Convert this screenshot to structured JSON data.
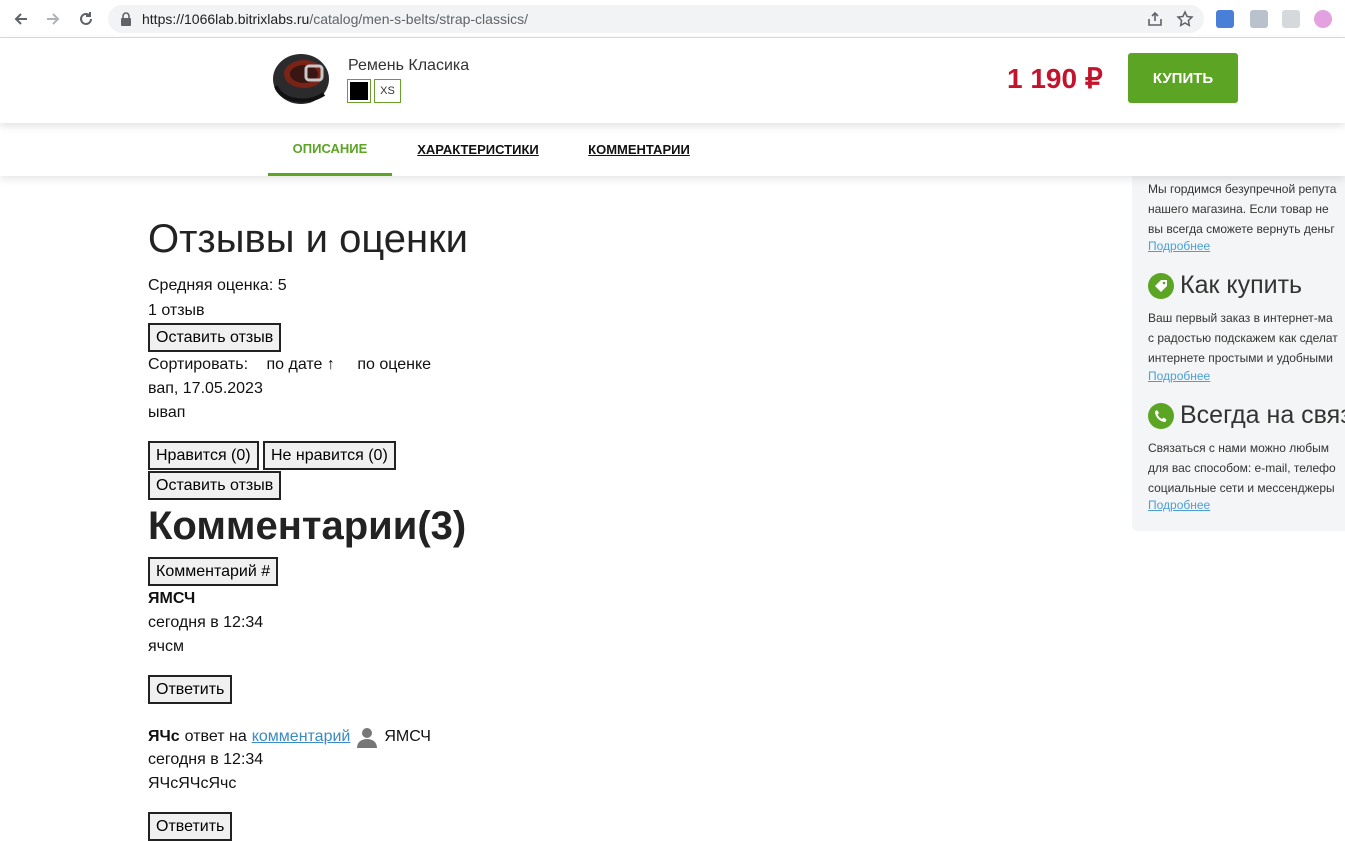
{
  "browser": {
    "url_host": "https://1066lab.bitrixlabs.ru",
    "url_path": "/catalog/men-s-belts/strap-classics/"
  },
  "product_bar": {
    "name": "Ремень Класика",
    "size": "XS",
    "price": "1 190 ₽",
    "buy_label": "КУПИТЬ",
    "color_selected": "#000000"
  },
  "tabs": [
    {
      "label": "ОПИСАНИЕ",
      "active": true
    },
    {
      "label": "ХАРАКТЕРИСТИКИ",
      "active": false
    },
    {
      "label": "КОММЕНТАРИИ",
      "active": false
    }
  ],
  "sidebar": {
    "block1": {
      "lines": [
        "Мы гордимся безупречной репута",
        "нашего магазина. Если товар не",
        "вы всегда сможете вернуть деньг"
      ],
      "link": "Подробнее"
    },
    "block2": {
      "title": "Как купить",
      "icon": "tag-icon",
      "lines": [
        "Ваш первый заказ в интернет-ма",
        "с радостью подскажем как сделат",
        "интернете простыми и удобными"
      ],
      "link": "Подробнее"
    },
    "block3": {
      "title": "Всегда на связ",
      "icon": "phone-icon",
      "lines": [
        "Связаться с нами можно любым",
        "для вас способом: e-mail, телефо",
        "социальные сети и мессенджеры"
      ],
      "link": "Подробнее"
    }
  },
  "reviews": {
    "title": "Отзывы и оценки",
    "avg_rating": "Средняя оценка: 5",
    "count": "1 отзыв",
    "leave_review": "Оставить отзыв",
    "sort_label": "Сортировать:",
    "sort_by_date": "по дате ↑",
    "sort_by_rating": "по оценке",
    "item": {
      "author_date": "вап, 17.05.2023",
      "text": "ывап",
      "like": "Нравится (0)",
      "dislike": "Не нравится (0)"
    },
    "leave_review_2": "Оставить отзыв"
  },
  "comments": {
    "title": "Комментарии(3)",
    "comment_btn": "Комментарий #",
    "c1": {
      "author": "ЯМСЧ",
      "time": "сегодня в 12:34",
      "text": "ячсм",
      "reply": "Ответить"
    },
    "c2": {
      "author": "ЯЧс",
      "reply_to": "ответ на",
      "reply_link": "комментарий",
      "reply_user": "ЯМСЧ",
      "time": "сегодня в 12:34",
      "text": "ЯЧсЯЧсЯчс",
      "reply": "Ответить"
    }
  }
}
